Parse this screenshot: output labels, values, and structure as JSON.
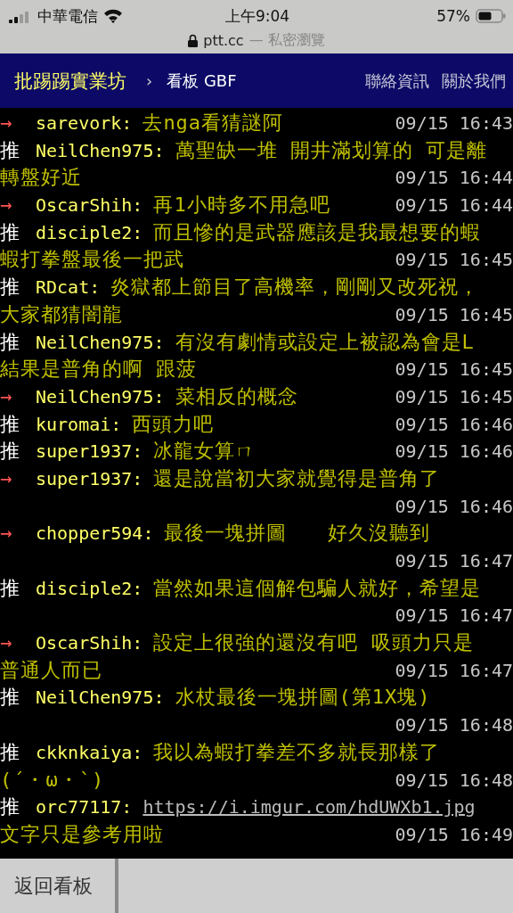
{
  "status_bar": {
    "carrier": "中華電信",
    "time": "上午9:04",
    "battery": "57%"
  },
  "address_bar": {
    "domain": "ptt.cc",
    "mode": "— 私密瀏覽"
  },
  "nav": {
    "site": "批踢踢實業坊",
    "separator": "›",
    "board": "看板 GBF",
    "links": [
      "聯絡資訊",
      "關於我們"
    ]
  },
  "comments": [
    {
      "kind": "arrow",
      "tag": "→",
      "user": "sarevork:",
      "content": "去nga看猜謎阿",
      "time": "09/15 16:43"
    },
    {
      "kind": "push",
      "tag": "推",
      "user": "NeilChen975:",
      "content": "萬聖缺一堆 開井滿划算的 可是離",
      "continuation": "轉盤好近",
      "time": "09/15 16:44",
      "time_below": true
    },
    {
      "kind": "arrow",
      "tag": "→",
      "user": "OscarShih:",
      "content": "再1小時多不用急吧",
      "time": "09/15 16:44"
    },
    {
      "kind": "push",
      "tag": "推",
      "user": "disciple2:",
      "content": "而且慘的是武器應該是我最想要的蝦",
      "continuation": "蝦打拳盤最後一把武",
      "time": "09/15 16:45",
      "time_below": true
    },
    {
      "kind": "push",
      "tag": "推",
      "user": "RDcat:",
      "content": "炎獄都上節目了高機率，剛剛又改死祝，",
      "continuation": "大家都猜闇龍",
      "time": "09/15 16:45",
      "time_below": true
    },
    {
      "kind": "push",
      "tag": "推",
      "user": "NeilChen975:",
      "content": "有沒有劇情或設定上被認為會是L",
      "continuation": "結果是普角的啊 跟菠",
      "time": "09/15 16:45",
      "time_below": true
    },
    {
      "kind": "arrow",
      "tag": "→",
      "user": "NeilChen975:",
      "content": "菜相反的概念",
      "time": "09/15 16:45"
    },
    {
      "kind": "push",
      "tag": "推",
      "user": "kuromai:",
      "content": "西頭力吧",
      "time": "09/15 16:46"
    },
    {
      "kind": "push",
      "tag": "推",
      "user": "super1937:",
      "content": "冰龍女算ㄇ",
      "time": "09/15 16:46"
    },
    {
      "kind": "arrow",
      "tag": "→",
      "user": "super1937:",
      "content": "還是說當初大家就覺得是普角了",
      "time": "09/15 16:46",
      "time_below": true
    },
    {
      "kind": "arrow",
      "tag": "→",
      "user": "chopper594:",
      "content": "最後一塊拼圖　　好久沒聽到",
      "time": "09/15 16:47",
      "time_below": true
    },
    {
      "kind": "push",
      "tag": "推",
      "user": "disciple2:",
      "content": "當然如果這個解包騙人就好，希望是",
      "time": "09/15 16:47",
      "time_below": true
    },
    {
      "kind": "arrow",
      "tag": "→",
      "user": "OscarShih:",
      "content": "設定上很強的還沒有吧 吸頭力只是",
      "continuation": "普通人而已",
      "time": "09/15 16:47",
      "time_below": true
    },
    {
      "kind": "push",
      "tag": "推",
      "user": "NeilChen975:",
      "content": "水杖最後一塊拼圖(第1X塊)",
      "time": "09/15 16:48",
      "time_below": true
    },
    {
      "kind": "push",
      "tag": "推",
      "user": "ckknkaiya:",
      "content": "我以為蝦打拳差不多就長那樣了",
      "continuation": "(´・ω・`)",
      "time": "09/15 16:48",
      "time_below": true
    },
    {
      "kind": "push",
      "tag": "推",
      "user": "orc77117:",
      "link": "https://i.imgur.com/hdUWXb1.jpg",
      "continuation": "文字只是參考用啦",
      "time": "09/15 16:49",
      "time_below": true
    }
  ],
  "footer": {
    "back": "返回看板"
  }
}
